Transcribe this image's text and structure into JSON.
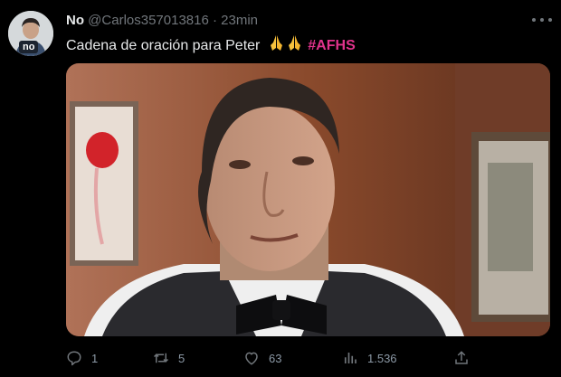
{
  "tweet": {
    "display_name": "No",
    "handle": "@Carlos357013816",
    "separator": "·",
    "time": "23min",
    "avatar_tag": "no",
    "text": "Cadena de oración para Peter",
    "emoji": "🙏🙏",
    "hashtag": "#AFHS"
  },
  "actions": {
    "reply": {
      "icon": "reply-icon",
      "count": "1"
    },
    "retweet": {
      "icon": "retweet-icon",
      "count": "5"
    },
    "like": {
      "icon": "heart-icon",
      "count": "63"
    },
    "views": {
      "icon": "views-icon",
      "count": "1.536"
    },
    "share": {
      "icon": "share-icon"
    }
  },
  "colors": {
    "background": "#000000",
    "text": "#e7e9ea",
    "muted": "#71767b",
    "hashtag": "#e0338b"
  }
}
